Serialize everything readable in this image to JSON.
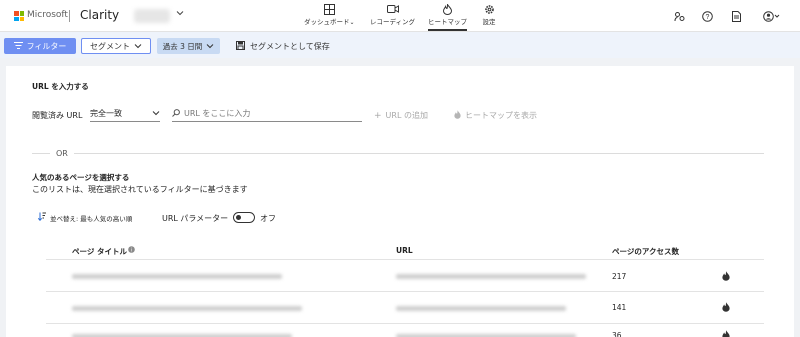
{
  "header": {
    "ms_name": "Microsoft",
    "app_name": "Clarity",
    "logo_colors": [
      "#f25022",
      "#7fba00",
      "#00a4ef",
      "#ffb900"
    ],
    "nav": [
      {
        "label": "ダッシュボード",
        "icon": "dashboard-icon",
        "has_dropdown": true
      },
      {
        "label": "レコーディング",
        "icon": "recording-icon"
      },
      {
        "label": "ヒートマップ",
        "icon": "heatmap-icon",
        "active": true
      },
      {
        "label": "設定",
        "icon": "gear-icon"
      }
    ],
    "right_icons": [
      "share-icon",
      "help-icon",
      "document-icon",
      "account-icon"
    ]
  },
  "toolbar": {
    "filter_label": "フィルター",
    "segment_label": "セグメント",
    "date_label": "過去 3 日間",
    "save_segment_label": "セグメントとして保存",
    "accent_color": "#6f8ff2"
  },
  "url_section": {
    "title": "URL を入力する",
    "viewed_url_label": "閲覧済み URL",
    "match_value": "完全一致",
    "url_placeholder": "URL をここに入力",
    "add_url_label": "URL の追加",
    "show_heatmap_label": "ヒートマップを表示",
    "or_label": "OR"
  },
  "popular_section": {
    "title": "人気のあるページを選択する",
    "description": "このリストは、現在選択されているフィルターに基づきます",
    "sort_label": "並べ替え: 最も人気の高い順",
    "url_param_label": "URL パラメーター",
    "toggle_state_label": "オフ"
  },
  "table": {
    "headers": {
      "title": "ページ タイトル",
      "url": "URL",
      "visits": "ページのアクセス数"
    },
    "rows": [
      {
        "visits": "217"
      },
      {
        "visits": "141"
      },
      {
        "visits": "36"
      }
    ]
  }
}
